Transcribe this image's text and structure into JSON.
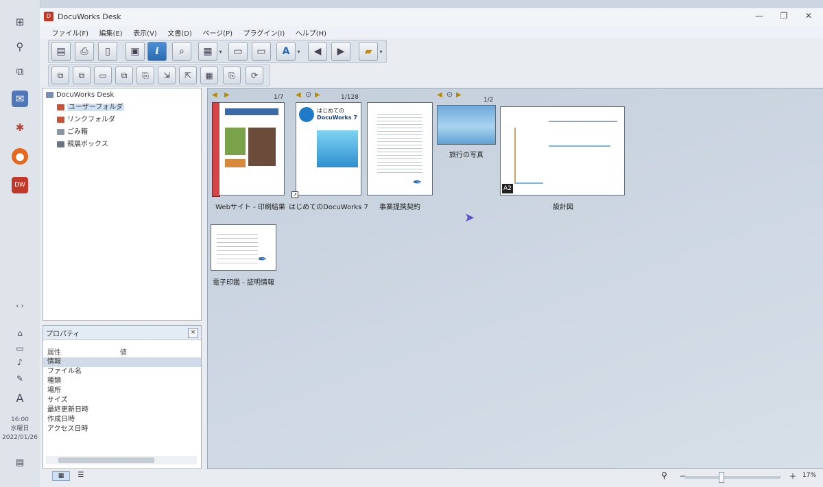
{
  "window": {
    "title": "DocuWorks Desk",
    "minimize": "—",
    "maximize": "❐",
    "close": "✕"
  },
  "menu": [
    "ファイル(F)",
    "編集(E)",
    "表示(V)",
    "文書(D)",
    "ページ(P)",
    "プラグイン(I)",
    "ヘルプ(H)"
  ],
  "toolbar1": [
    {
      "icon": "scanner-icon",
      "glyph": "▤"
    },
    {
      "icon": "printer-icon",
      "glyph": "⎙"
    },
    {
      "icon": "document-icon",
      "glyph": "▯"
    },
    {
      "icon": "viewer-icon",
      "glyph": "▣"
    },
    {
      "icon": "info-icon",
      "glyph": "i"
    },
    {
      "icon": "binoculars-icon",
      "glyph": "⌕"
    },
    {
      "icon": "grid-icon",
      "glyph": "▦"
    },
    {
      "icon": "clipboard-icon",
      "glyph": "▭"
    },
    {
      "icon": "paste-icon",
      "glyph": "▭"
    },
    {
      "icon": "convert-icon",
      "glyph": "A"
    },
    {
      "icon": "back-arrow-icon",
      "glyph": "◀"
    },
    {
      "icon": "forward-arrow-icon",
      "glyph": "▶"
    },
    {
      "icon": "folder-view-icon",
      "glyph": "▰"
    }
  ],
  "toolbar2": [
    {
      "icon": "bind-icon",
      "glyph": "⧉"
    },
    {
      "icon": "unbind-icon",
      "glyph": "⧉"
    },
    {
      "icon": "page-icon",
      "glyph": "▭"
    },
    {
      "icon": "copy-page-icon",
      "glyph": "⧉"
    },
    {
      "icon": "extract-icon",
      "glyph": "⎘"
    },
    {
      "icon": "export-icon",
      "glyph": "⇲"
    },
    {
      "icon": "insert-icon",
      "glyph": "⇱"
    },
    {
      "icon": "ocr-icon",
      "glyph": "▦"
    },
    {
      "icon": "attach-icon",
      "glyph": "⎘"
    },
    {
      "icon": "refresh-icon",
      "glyph": "⟳"
    }
  ],
  "tree": {
    "root": "DocuWorks Desk",
    "items": [
      "ユーザーフォルダ",
      "リンクフォルダ",
      "ごみ箱",
      "親展ボックス"
    ]
  },
  "properties": {
    "title": "プロパティ",
    "col_attr": "属性",
    "col_value": "値",
    "rows": [
      "情報",
      "ファイル名",
      "種類",
      "場所",
      "サイズ",
      "最終更新日時",
      "作成日時",
      "アクセス日時"
    ]
  },
  "documents": [
    {
      "label": "Webサイト - 印刷結果",
      "pages": "1/7"
    },
    {
      "label": "はじめてのDocuWorks 7",
      "pages": "1/128",
      "cover_title": "はじめての",
      "cover_sub": "DocuWorks 7"
    },
    {
      "label": "事業提携契約"
    },
    {
      "label": "旅行の写真",
      "pages": "1/2"
    },
    {
      "label": "設計図",
      "badge": "A2"
    },
    {
      "label": "電子印鑑 - 証明情報"
    }
  ],
  "taskbar": {
    "time": "16:00",
    "day": "水曜日",
    "date": "2022/01/26",
    "ime": "A"
  },
  "status": {
    "zoom": "17%",
    "zoom_minus": "－",
    "zoom_plus": "＋"
  },
  "colors": {
    "accent": "#2a6bb2",
    "binder": "#d64545",
    "folder": "#c4553b"
  }
}
